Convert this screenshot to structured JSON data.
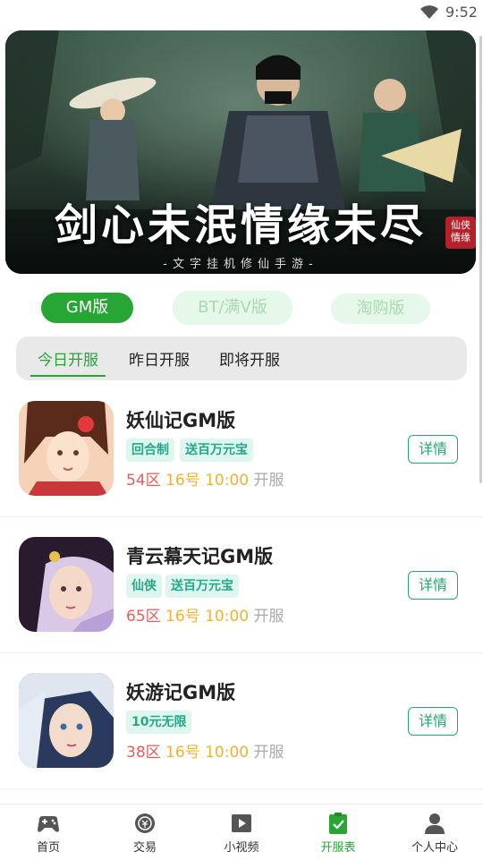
{
  "status": {
    "time": "9:52",
    "wifi_icon": "wifi-icon"
  },
  "banner": {
    "slogan": "剑心未泯情缘未尽",
    "subtitle": "-文字挂机修仙手游-",
    "seal": "仙侠\n情缘"
  },
  "version_tabs": [
    {
      "label": "GM版",
      "active": true
    },
    {
      "label": "BT/满V版",
      "active": false
    },
    {
      "label": "淘购版",
      "active": false
    }
  ],
  "day_tabs": [
    {
      "label": "今日开服",
      "active": true
    },
    {
      "label": "昨日开服",
      "active": false
    },
    {
      "label": "即将开服",
      "active": false
    }
  ],
  "games": [
    {
      "name": "妖仙记GM版",
      "tags": [
        "回合制",
        "送百万元宝"
      ],
      "zone": "54区",
      "date": "16号 10:00",
      "open": "开服",
      "detail": "详情"
    },
    {
      "name": "青云幕天记GM版",
      "tags": [
        "仙侠",
        "送百万元宝"
      ],
      "zone": "65区",
      "date": "16号 10:00",
      "open": "开服",
      "detail": "详情"
    },
    {
      "name": "妖游记GM版",
      "tags": [
        "10元无限"
      ],
      "zone": "38区",
      "date": "16号 10:00",
      "open": "开服",
      "detail": "详情"
    }
  ],
  "tabbar": [
    {
      "label": "首页",
      "icon": "gamepad-icon"
    },
    {
      "label": "交易",
      "icon": "trade-icon"
    },
    {
      "label": "小视频",
      "icon": "video-play-icon"
    },
    {
      "label": "开服表",
      "icon": "clipboard-check-icon",
      "active": true
    },
    {
      "label": "个人中心",
      "icon": "user-icon"
    }
  ],
  "colors": {
    "accent": "#27a535",
    "tag_bg": "#dff6ee",
    "zone": "#ee5a5a",
    "date": "#f2b12e"
  }
}
